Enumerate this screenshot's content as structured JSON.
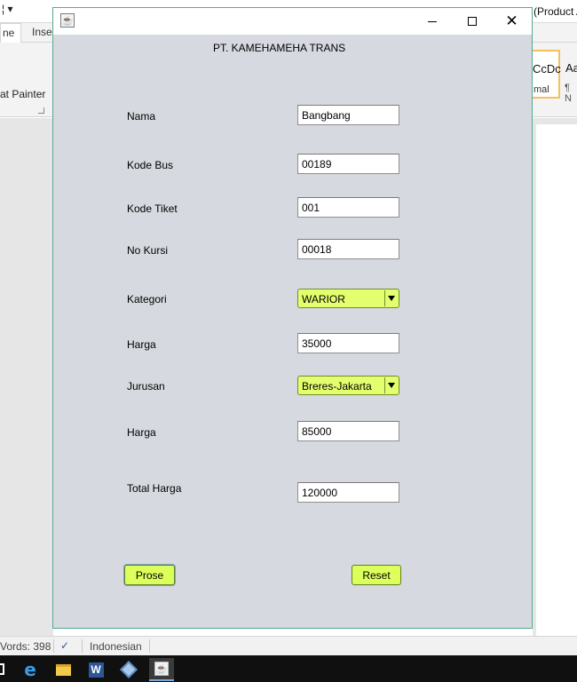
{
  "background_app": {
    "qat_glyph": "¦ ▾",
    "title_right": "(Product A",
    "tabs": [
      "ne",
      "Inser"
    ],
    "format_painter_label": "at Painter",
    "styles": [
      {
        "preview": "CcDc",
        "name": "mal"
      },
      {
        "preview": "Aa",
        "name": "¶ N"
      }
    ],
    "status": {
      "words": "Vords: 398",
      "language": "Indonesian"
    }
  },
  "window": {
    "title": "",
    "controls": {
      "minimize": "—",
      "maximize": "☐",
      "close": "✕"
    }
  },
  "form": {
    "heading": "PT. KAMEHAMEHA TRANS",
    "fields": {
      "nama": {
        "label": "Nama",
        "value": "Bangbang"
      },
      "kode_bus": {
        "label": "Kode Bus",
        "value": "00189"
      },
      "kode_tiket": {
        "label": "Kode Tiket",
        "value": "001"
      },
      "no_kursi": {
        "label": "No Kursi",
        "value": "00018"
      },
      "kategori": {
        "label": "Kategori",
        "selected": "WARIOR"
      },
      "harga_kategori": {
        "label": "Harga",
        "value": "35000"
      },
      "jurusan": {
        "label": "Jurusan",
        "selected": "Breres-Jakarta"
      },
      "harga_jurusan": {
        "label": "Harga",
        "value": "85000"
      },
      "total_harga": {
        "label": "Total Harga",
        "value": "120000"
      }
    },
    "buttons": {
      "process": "Prose",
      "reset": "Reset"
    }
  },
  "colors": {
    "panel_bg": "#d6d9df",
    "button_bg": "#ddff5c",
    "combo_bg": "#e4ff6e",
    "window_border": "#56a98f"
  }
}
